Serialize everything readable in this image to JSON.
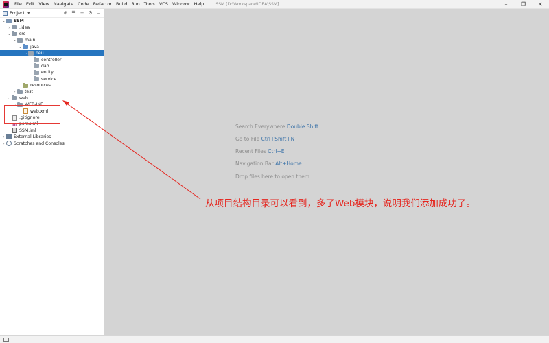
{
  "menu_bar": {
    "items": [
      "File",
      "Edit",
      "View",
      "Navigate",
      "Code",
      "Refactor",
      "Build",
      "Run",
      "Tools",
      "VCS",
      "Window",
      "Help"
    ],
    "window_title": "SSM [D:\\Workspace\\IDEA\\SSM]",
    "controls": {
      "minimize": "–",
      "restore": "❐",
      "close": "✕"
    }
  },
  "project_panel": {
    "title": "Project",
    "tools": [
      "⊕",
      "☰",
      "÷",
      "⚙",
      "–"
    ]
  },
  "tree": {
    "ssm": "SSM",
    "idea": ".idea",
    "src": "src",
    "main": "main",
    "java": "java",
    "neu": "neu",
    "controller": "controller",
    "dao": "dao",
    "entity": "entity",
    "service": "service",
    "resources": "resources",
    "test": "test",
    "web": "web",
    "web_inf": "WEB-INF",
    "web_xml": "web.xml",
    "gitignore": ".gitignore",
    "pom": "pom.xml",
    "iml": "SSM.iml",
    "external_libraries": "External Libraries",
    "scratches": "Scratches and Consoles"
  },
  "editor_hints": [
    {
      "text": "Search Everywhere",
      "key": "Double Shift"
    },
    {
      "text": "Go to File",
      "key": "Ctrl+Shift+N"
    },
    {
      "text": "Recent Files",
      "key": "Ctrl+E"
    },
    {
      "text": "Navigation Bar",
      "key": "Alt+Home"
    },
    {
      "text": "Drop files here to open them",
      "key": ""
    }
  ],
  "annotation": "从项目结构目录可以看到，多了Web模块，说明我们添加成功了。",
  "colors": {
    "selection": "#2675bf",
    "annotation": "#e5261f",
    "hint_key": "#3c73a8"
  }
}
